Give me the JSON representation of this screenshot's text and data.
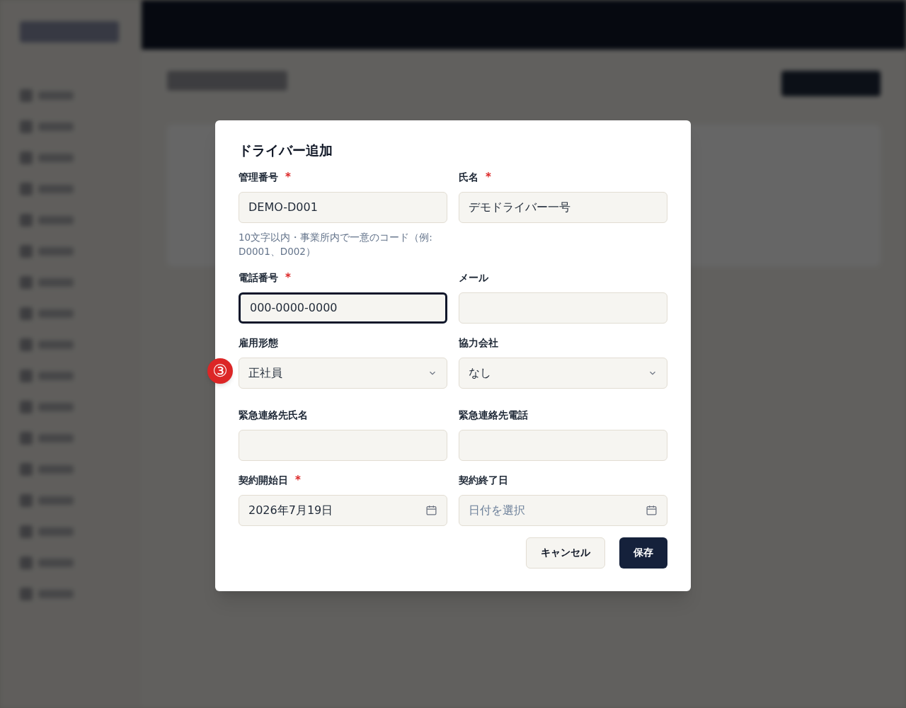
{
  "dialog": {
    "title": "ドライバー追加",
    "fields": [
      {
        "kind": "text",
        "label": "管理番号",
        "required_mark": "*",
        "value": "DEMO-D001",
        "focused": false,
        "hint": "10文字以内・事業所内で一意のコード（例: D0001、D002）"
      },
      {
        "kind": "text",
        "label": "氏名",
        "required_mark": "*",
        "value": "デモドライバー一号",
        "focused": false
      },
      {
        "kind": "text",
        "label": "電話番号",
        "required_mark": "*",
        "value": "000-0000-0000",
        "focused": true
      },
      {
        "kind": "text",
        "label": "メール",
        "focused": false
      },
      {
        "kind": "select",
        "label": "雇用形態",
        "value": "正社員",
        "focused": false
      },
      {
        "kind": "select",
        "label": "協力会社",
        "value": "なし",
        "focused": false
      },
      {
        "kind": "text",
        "label": "緊急連絡先氏名",
        "focused": false
      },
      {
        "kind": "text",
        "label": "緊急連絡先電話",
        "focused": false
      },
      {
        "kind": "date",
        "label": "契約開始日",
        "required_mark": "*",
        "value": "2026年7月19日",
        "focused": false
      },
      {
        "kind": "date",
        "label": "契約終了日",
        "placeholder": "日付を選択",
        "focused": false
      }
    ],
    "buttons": [
      {
        "kind": "secondary",
        "label": "キャンセル"
      },
      {
        "kind": "primary",
        "label": "保存"
      }
    ]
  },
  "step_badge": "③"
}
